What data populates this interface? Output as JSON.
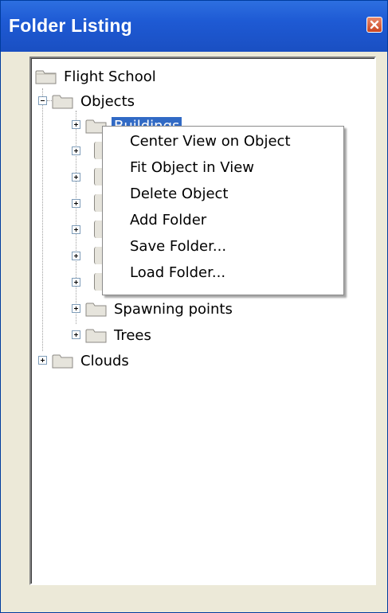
{
  "window": {
    "title": "Folder Listing",
    "close_icon": "close-icon"
  },
  "tree": {
    "root": {
      "label": "Flight School",
      "icon": "folder-icon"
    },
    "objects": {
      "label": "Objects",
      "expanded": true
    },
    "selected_child": {
      "label": "Buildings",
      "selected": true
    },
    "hidden_children_count_visible_expanders": 6,
    "spawning_points": {
      "label": "Spawning points"
    },
    "trees": {
      "label": "Trees"
    },
    "clouds": {
      "label": "Clouds"
    }
  },
  "context_menu": {
    "items": [
      "Center View on Object",
      "Fit Object in View",
      "Delete Object",
      "Add Folder",
      "Save Folder...",
      "Load Folder..."
    ]
  },
  "colors": {
    "titlebar": "#1e5ad4",
    "selection": "#316ac5",
    "close_button": "#c9441f"
  }
}
